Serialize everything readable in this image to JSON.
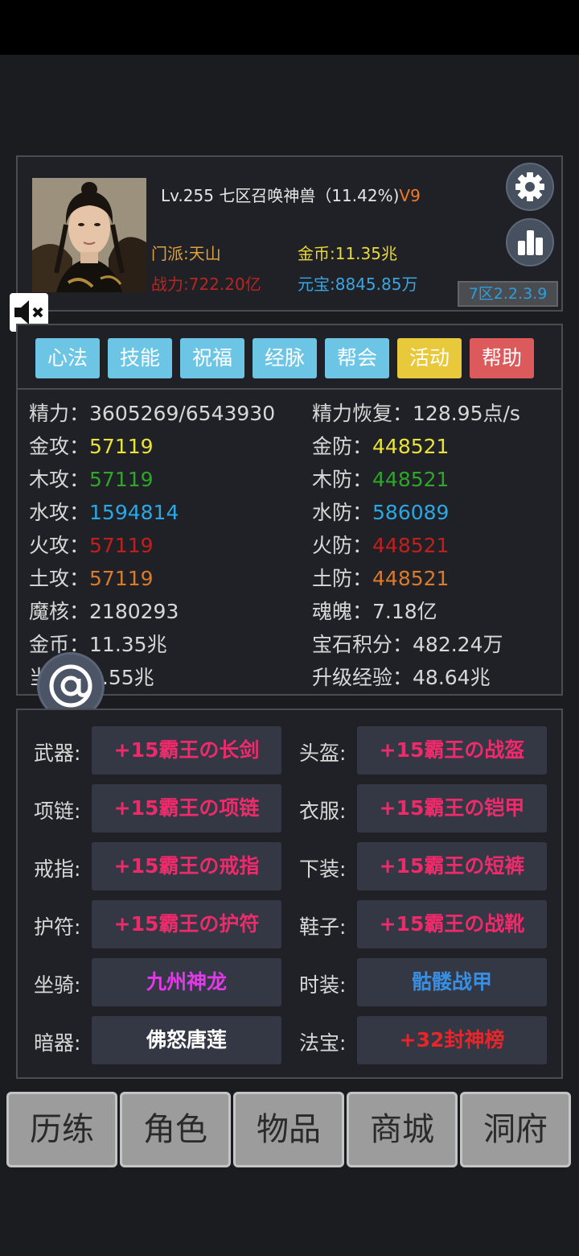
{
  "profile": {
    "level_text": "Lv.255 七区召唤神兽（11.42%)",
    "vip": "V9",
    "sect": "门派:天山",
    "power": "战力:722.20亿",
    "gold": "金币:11.35兆",
    "ingot": "元宝:8845.85万",
    "version": "7区2.2.3.9"
  },
  "tabs": [
    {
      "label": "心法",
      "color": "#6cc5e4"
    },
    {
      "label": "技能",
      "color": "#6cc5e4"
    },
    {
      "label": "祝福",
      "color": "#6cc5e4"
    },
    {
      "label": "经脉",
      "color": "#6cc5e4"
    },
    {
      "label": "帮会",
      "color": "#6cc5e4"
    },
    {
      "label": "活动",
      "color": "#e8c93c"
    },
    {
      "label": "帮助",
      "color": "#dc5a5b"
    }
  ],
  "stats": {
    "left": [
      {
        "label": "精力：",
        "value": "3605269/6543930",
        "color": "#d8d8d8"
      },
      {
        "label": "金攻：",
        "value": "57119",
        "color": "#e8e23a"
      },
      {
        "label": "木攻：",
        "value": "57119",
        "color": "#2fa52a"
      },
      {
        "label": "水攻：",
        "value": "1594814",
        "color": "#2aa8e6"
      },
      {
        "label": "火攻：",
        "value": "57119",
        "color": "#c0201c"
      },
      {
        "label": "土攻：",
        "value": "57119",
        "color": "#d97a2c"
      },
      {
        "label": "魔核：",
        "value": "2180293",
        "color": "#d8d8d8"
      },
      {
        "label": "金币：",
        "value": "11.35兆",
        "color": "#d8d8d8"
      },
      {
        "label": "当",
        "value": "验：5.55兆",
        "color": "#d8d8d8"
      }
    ],
    "right": [
      {
        "label": "精力恢复：",
        "value": "128.95点/s",
        "color": "#d8d8d8"
      },
      {
        "label": "金防：",
        "value": "448521",
        "color": "#e8e23a"
      },
      {
        "label": "木防：",
        "value": "448521",
        "color": "#2fa52a"
      },
      {
        "label": "水防：",
        "value": "586089",
        "color": "#2aa8e6"
      },
      {
        "label": "火防：",
        "value": "448521",
        "color": "#c0201c"
      },
      {
        "label": "土防：",
        "value": "448521",
        "color": "#d97a2c"
      },
      {
        "label": "魂魄：",
        "value": "7.18亿",
        "color": "#d8d8d8"
      },
      {
        "label": "宝石积分：",
        "value": "482.24万",
        "color": "#d8d8d8"
      },
      {
        "label": "升级经验：",
        "value": "48.64兆",
        "color": "#d8d8d8"
      }
    ]
  },
  "equipment": [
    {
      "label": "武器:",
      "item": "+15霸王の长剑",
      "color": "#ef2a6a"
    },
    {
      "label": "头盔:",
      "item": "+15霸王の战盔",
      "color": "#ef2a6a"
    },
    {
      "label": "项链:",
      "item": "+15霸王の项链",
      "color": "#ef2a6a"
    },
    {
      "label": "衣服:",
      "item": "+15霸王の铠甲",
      "color": "#ef2a6a"
    },
    {
      "label": "戒指:",
      "item": "+15霸王の戒指",
      "color": "#ef2a6a"
    },
    {
      "label": "下装:",
      "item": "+15霸王の短裤",
      "color": "#ef2a6a"
    },
    {
      "label": "护符:",
      "item": "+15霸王の护符",
      "color": "#ef2a6a"
    },
    {
      "label": "鞋子:",
      "item": "+15霸王の战靴",
      "color": "#ef2a6a"
    },
    {
      "label": "坐骑:",
      "item": "九州神龙",
      "color": "#e23ae8"
    },
    {
      "label": "时装:",
      "item": "骷髅战甲",
      "color": "#3a8ee0"
    },
    {
      "label": "暗器:",
      "item": "佛怒唐莲",
      "color": "#ffffff"
    },
    {
      "label": "法宝:",
      "item": "+32封神榜",
      "color": "#e6262a"
    }
  ],
  "nav": [
    "历练",
    "角色",
    "物品",
    "商城",
    "洞府"
  ],
  "icons": {
    "settings": "gear-icon",
    "ranking": "bar-chart-icon",
    "mute": "speaker-muted-icon",
    "chat": "at-sign-icon"
  }
}
